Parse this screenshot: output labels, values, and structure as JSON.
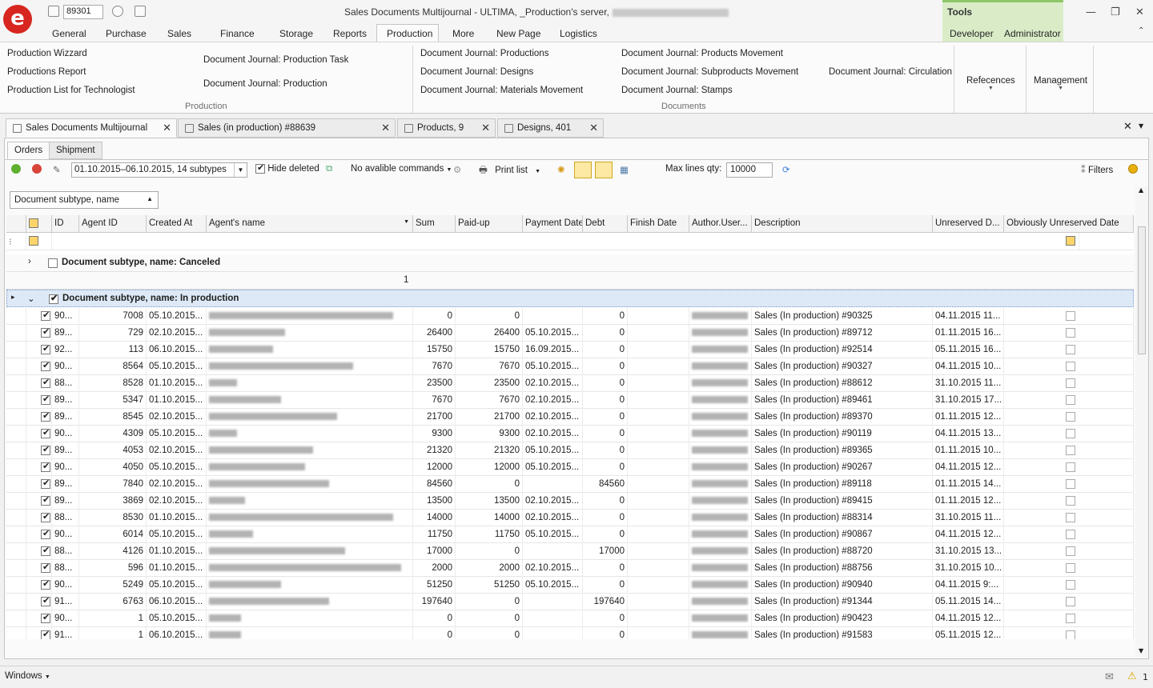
{
  "quick_access": {
    "doc_number": "89301"
  },
  "window": {
    "title": "Sales Documents Multijournal - ULTIMA, _Production's server,"
  },
  "menu_tabs": [
    "General",
    "Purchase",
    "Sales",
    "Finance",
    "Storage",
    "Reports",
    "Production",
    "More",
    "New Page",
    "Logistics"
  ],
  "active_menu_tab": "Production",
  "tools": {
    "label": "Tools",
    "tabs": [
      "Developer",
      "Administrator"
    ]
  },
  "ribbon": {
    "production_items_col1": [
      "Production Wizzard",
      "Productions Report",
      "Production List for Technologist"
    ],
    "production_items_col2": [
      "Document Journal: Production Task",
      "Document Journal: Production"
    ],
    "production_group": "Production",
    "documents_col1": [
      "Document Journal: Productions",
      "Document Journal: Designs",
      "Document Journal: Materials Movement"
    ],
    "documents_col2": [
      "Document Journal: Products Movement",
      "Document Journal: Subproducts Movement",
      "Document Journal: Stamps"
    ],
    "documents_col3": [
      "Document Journal: Circulation"
    ],
    "documents_group": "Documents",
    "references": "Refecences",
    "management": "Management"
  },
  "doc_tabs": [
    "Sales Documents Multijournal",
    "Sales (in production) #88639",
    "Products, 9",
    "Designs, 401"
  ],
  "sub_tabs": [
    "Orders",
    "Shipment"
  ],
  "toolbar": {
    "period": "01.10.2015–06.10.2015, 14 subtypes",
    "hide_deleted": "Hide deleted",
    "commands": "No avalible commands",
    "print": "Print list",
    "max_lines_label": "Max lines qty:",
    "max_lines": "10000",
    "filters": "Filters"
  },
  "group_by": "Document subtype, name",
  "columns": [
    "ID",
    "Agent ID",
    "Created At",
    "Agent's name",
    "Sum",
    "Paid-up",
    "Payment Date",
    "Debt",
    "Finish Date",
    "Author.User...",
    "Description",
    "Unreserved D...",
    "Obviously Unreserved Date"
  ],
  "groups": {
    "canceled": "Document subtype, name: Canceled",
    "canceled_count": "1",
    "in_production": "Document subtype, name: In production"
  },
  "rows": [
    {
      "id": "90...",
      "agent": "7008",
      "created": "05.10.2015...",
      "sum": "0",
      "paid": "0",
      "paydate": "",
      "debt": "0",
      "desc": "Sales (In production) #90325",
      "unres": "04.11.2015 11..."
    },
    {
      "id": "89...",
      "agent": "729",
      "created": "02.10.2015...",
      "sum": "26400",
      "paid": "26400",
      "paydate": "05.10.2015...",
      "debt": "0",
      "desc": "Sales (In production) #89712",
      "unres": "01.11.2015 16..."
    },
    {
      "id": "92...",
      "agent": "113",
      "created": "06.10.2015...",
      "sum": "15750",
      "paid": "15750",
      "paydate": "16.09.2015...",
      "debt": "0",
      "desc": "Sales (In production) #92514",
      "unres": "05.11.2015 16..."
    },
    {
      "id": "90...",
      "agent": "8564",
      "created": "05.10.2015...",
      "sum": "7670",
      "paid": "7670",
      "paydate": "05.10.2015...",
      "debt": "0",
      "desc": "Sales (In production) #90327",
      "unres": "04.11.2015 10..."
    },
    {
      "id": "88...",
      "agent": "8528",
      "created": "01.10.2015...",
      "sum": "23500",
      "paid": "23500",
      "paydate": "02.10.2015...",
      "debt": "0",
      "desc": "Sales (In production) #88612",
      "unres": "31.10.2015 11..."
    },
    {
      "id": "89...",
      "agent": "5347",
      "created": "01.10.2015...",
      "sum": "7670",
      "paid": "7670",
      "paydate": "02.10.2015...",
      "debt": "0",
      "desc": "Sales (In production) #89461",
      "unres": "31.10.2015 17..."
    },
    {
      "id": "89...",
      "agent": "8545",
      "created": "02.10.2015...",
      "sum": "21700",
      "paid": "21700",
      "paydate": "02.10.2015...",
      "debt": "0",
      "desc": "Sales (In production) #89370",
      "unres": "01.11.2015 12..."
    },
    {
      "id": "90...",
      "agent": "4309",
      "created": "05.10.2015...",
      "sum": "9300",
      "paid": "9300",
      "paydate": "02.10.2015...",
      "debt": "0",
      "desc": "Sales (In production) #90119",
      "unres": "04.11.2015 13..."
    },
    {
      "id": "89...",
      "agent": "4053",
      "created": "02.10.2015...",
      "sum": "21320",
      "paid": "21320",
      "paydate": "05.10.2015...",
      "debt": "0",
      "desc": "Sales (In production) #89365",
      "unres": "01.11.2015 10..."
    },
    {
      "id": "90...",
      "agent": "4050",
      "created": "05.10.2015...",
      "sum": "12000",
      "paid": "12000",
      "paydate": "05.10.2015...",
      "debt": "0",
      "desc": "Sales (In production) #90267",
      "unres": "04.11.2015 12..."
    },
    {
      "id": "89...",
      "agent": "7840",
      "created": "02.10.2015...",
      "sum": "84560",
      "paid": "0",
      "paydate": "",
      "debt": "84560",
      "desc": "Sales (In production) #89118",
      "unres": "01.11.2015 14..."
    },
    {
      "id": "89...",
      "agent": "3869",
      "created": "02.10.2015...",
      "sum": "13500",
      "paid": "13500",
      "paydate": "02.10.2015...",
      "debt": "0",
      "desc": "Sales (In production) #89415",
      "unres": "01.11.2015 12..."
    },
    {
      "id": "88...",
      "agent": "8530",
      "created": "01.10.2015...",
      "sum": "14000",
      "paid": "14000",
      "paydate": "02.10.2015...",
      "debt": "0",
      "desc": "Sales (In production) #88314",
      "unres": "31.10.2015 11..."
    },
    {
      "id": "90...",
      "agent": "6014",
      "created": "05.10.2015...",
      "sum": "11750",
      "paid": "11750",
      "paydate": "05.10.2015...",
      "debt": "0",
      "desc": "Sales (In production) #90867",
      "unres": "04.11.2015 12..."
    },
    {
      "id": "88...",
      "agent": "4126",
      "created": "01.10.2015...",
      "sum": "17000",
      "paid": "0",
      "paydate": "",
      "debt": "17000",
      "desc": "Sales (In production) #88720",
      "unres": "31.10.2015 13..."
    },
    {
      "id": "88...",
      "agent": "596",
      "created": "01.10.2015...",
      "sum": "2000",
      "paid": "2000",
      "paydate": "02.10.2015...",
      "debt": "0",
      "desc": "Sales (In production) #88756",
      "unres": "31.10.2015 10..."
    },
    {
      "id": "90...",
      "agent": "5249",
      "created": "05.10.2015...",
      "sum": "51250",
      "paid": "51250",
      "paydate": "05.10.2015...",
      "debt": "0",
      "desc": "Sales (In production) #90940",
      "unres": "04.11.2015 9:..."
    },
    {
      "id": "91...",
      "agent": "6763",
      "created": "06.10.2015...",
      "sum": "197640",
      "paid": "0",
      "paydate": "",
      "debt": "197640",
      "desc": "Sales (In production) #91344",
      "unres": "05.11.2015 14..."
    },
    {
      "id": "90...",
      "agent": "1",
      "created": "05.10.2015...",
      "sum": "0",
      "paid": "0",
      "paydate": "",
      "debt": "0",
      "desc": "Sales (In production) #90423",
      "unres": "04.11.2015 12..."
    },
    {
      "id": "91...",
      "agent": "1",
      "created": "06.10.2015...",
      "sum": "0",
      "paid": "0",
      "paydate": "",
      "debt": "0",
      "desc": "Sales (In production) #91583",
      "unres": "05.11.2015 12..."
    }
  ],
  "status": {
    "windows": "Windows",
    "warnings": "1"
  },
  "colors": {
    "accent": "#d7261f",
    "tools_bg": "#d9ecc7",
    "toggle_bg": "#fde9a3"
  }
}
